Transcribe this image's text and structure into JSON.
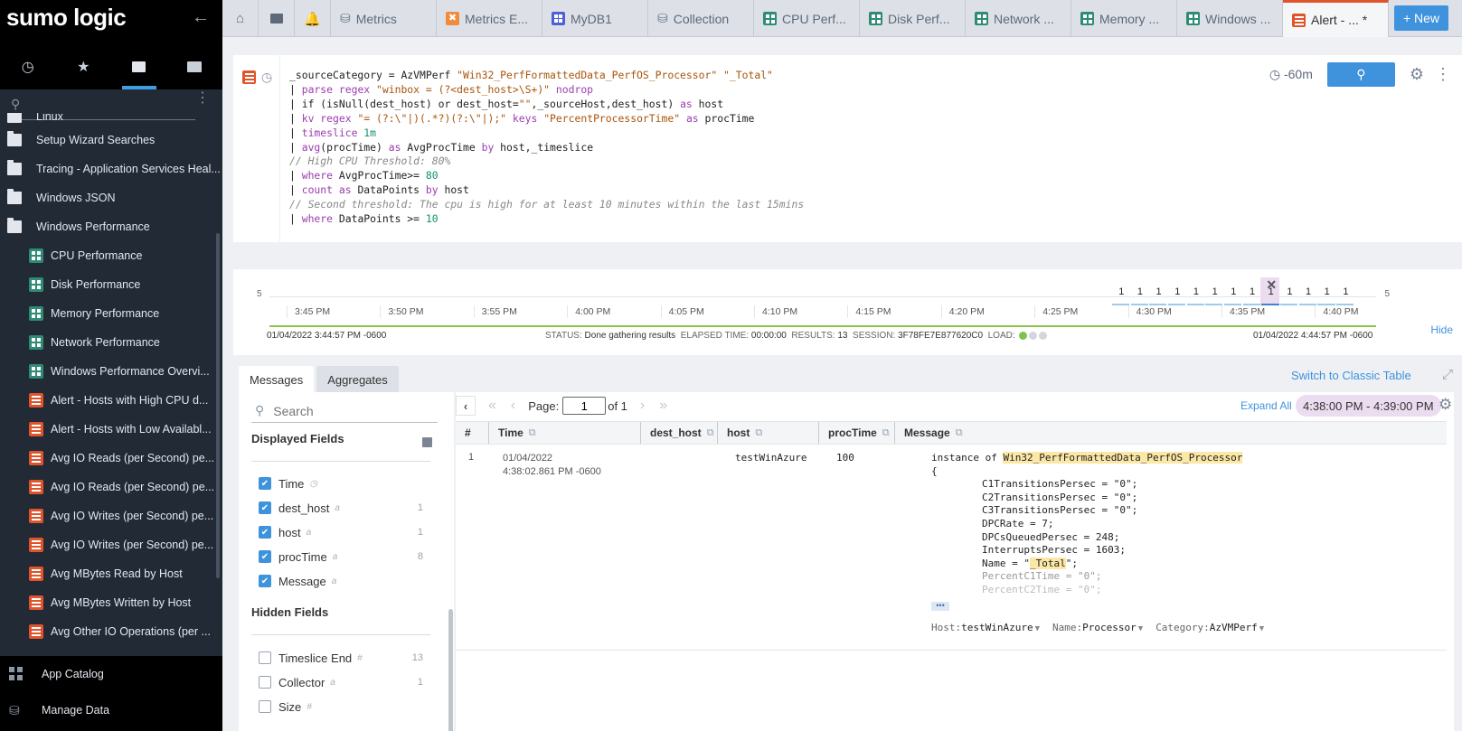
{
  "sidebar": {
    "logo": "sumo logic",
    "tabs": [
      {
        "icon": "clock-icon",
        "label": "Recent"
      },
      {
        "icon": "star-icon",
        "label": "Favorites"
      },
      {
        "icon": "personal-folder-icon",
        "label": "Personal",
        "active": true
      },
      {
        "icon": "library-folder-icon",
        "label": "Library"
      }
    ],
    "search": {
      "placeholder": "",
      "value": ""
    },
    "items": [
      {
        "label": "Linux",
        "type": "folder",
        "level": 0
      },
      {
        "label": "Setup Wizard Searches",
        "type": "folder",
        "level": 0
      },
      {
        "label": "Tracing - Application Services Heal...",
        "type": "folder",
        "level": 0
      },
      {
        "label": "Windows JSON",
        "type": "folder",
        "level": 0
      },
      {
        "label": "Windows Performance",
        "type": "folder-open",
        "level": 0
      },
      {
        "label": "CPU Performance",
        "type": "dashboard",
        "level": 1
      },
      {
        "label": "Disk Performance",
        "type": "dashboard",
        "level": 1
      },
      {
        "label": "Memory Performance",
        "type": "dashboard",
        "level": 1
      },
      {
        "label": "Network Performance",
        "type": "dashboard",
        "level": 1
      },
      {
        "label": "Windows Performance Overvi...",
        "type": "dashboard",
        "level": 1
      },
      {
        "label": "Alert - Hosts with High CPU d...",
        "type": "search",
        "level": 1
      },
      {
        "label": "Alert - Hosts with Low Availabl...",
        "type": "search",
        "level": 1
      },
      {
        "label": "Avg IO Reads (per Second) pe...",
        "type": "search",
        "level": 1
      },
      {
        "label": "Avg IO Reads (per Second) pe...",
        "type": "search",
        "level": 1
      },
      {
        "label": "Avg IO Writes (per Second) pe...",
        "type": "search",
        "level": 1
      },
      {
        "label": "Avg IO Writes (per Second) pe...",
        "type": "search",
        "level": 1
      },
      {
        "label": "Avg MBytes Read by Host",
        "type": "search",
        "level": 1
      },
      {
        "label": "Avg MBytes Written by Host",
        "type": "search",
        "level": 1
      },
      {
        "label": "Avg Other IO Operations (per ...",
        "type": "search",
        "level": 1
      }
    ],
    "bottom": [
      {
        "label": "App Catalog",
        "icon": "app-catalog-icon"
      },
      {
        "label": "Manage Data",
        "icon": "database-icon"
      }
    ]
  },
  "tabbar": {
    "tabs": [
      {
        "label": "Metrics",
        "icon": "database-icon"
      },
      {
        "label": "Metrics E...",
        "icon": "metrics-explorer-icon"
      },
      {
        "label": "MyDB1",
        "icon": "dashboard-blue-icon"
      },
      {
        "label": "Collection",
        "icon": "database-icon"
      },
      {
        "label": "CPU Perf...",
        "icon": "dashboard-icon"
      },
      {
        "label": "Disk Perf...",
        "icon": "dashboard-icon"
      },
      {
        "label": "Network ...",
        "icon": "dashboard-icon"
      },
      {
        "label": "Memory ...",
        "icon": "dashboard-icon"
      },
      {
        "label": "Windows ...",
        "icon": "dashboard-icon"
      },
      {
        "label": "Alert - ... *",
        "icon": "search-doc-icon",
        "active": true
      }
    ],
    "new_label": "+ New"
  },
  "query": {
    "lines": [
      [
        {
          "t": "_sourceCategory = AzVMPerf "
        },
        {
          "c": "str",
          "t": "\"Win32_PerfFormattedData_PerfOS_Processor\" \"_Total\""
        }
      ],
      [
        {
          "t": "| "
        },
        {
          "c": "kw",
          "t": "parse regex "
        },
        {
          "c": "str",
          "t": "\"winbox = (?<dest_host>\\S+)\" "
        },
        {
          "c": "kw",
          "t": "nodrop"
        }
      ],
      [
        {
          "t": "| if (isNull(dest_host) or dest_host="
        },
        {
          "c": "str",
          "t": "\"\""
        },
        {
          "t": ",_sourceHost,dest_host) "
        },
        {
          "c": "kw",
          "t": "as"
        },
        {
          "t": " host"
        }
      ],
      [
        {
          "t": "| "
        },
        {
          "c": "kw",
          "t": "kv regex "
        },
        {
          "c": "str",
          "t": "\"= (?:\\\"|)(.*?)(?:\\\"|);\" "
        },
        {
          "c": "kw",
          "t": "keys "
        },
        {
          "c": "str",
          "t": "\"PercentProcessorTime\" "
        },
        {
          "c": "kw",
          "t": "as"
        },
        {
          "t": " procTime"
        }
      ],
      [
        {
          "t": "| "
        },
        {
          "c": "kw",
          "t": "timeslice "
        },
        {
          "c": "num",
          "t": "1m"
        }
      ],
      [
        {
          "t": "| "
        },
        {
          "c": "kw",
          "t": "avg"
        },
        {
          "t": "(procTime) "
        },
        {
          "c": "kw",
          "t": "as"
        },
        {
          "t": " AvgProcTime "
        },
        {
          "c": "kw",
          "t": "by"
        },
        {
          "t": " host,_timeslice"
        }
      ],
      [
        {
          "c": "cmt",
          "t": "// High CPU Threshold: 80%"
        }
      ],
      [
        {
          "t": "| "
        },
        {
          "c": "kw",
          "t": "where"
        },
        {
          "t": " AvgProcTime>= "
        },
        {
          "c": "num",
          "t": "80"
        }
      ],
      [
        {
          "t": "| "
        },
        {
          "c": "kw",
          "t": "count as"
        },
        {
          "t": " DataPoints "
        },
        {
          "c": "kw",
          "t": "by"
        },
        {
          "t": " host"
        }
      ],
      [
        {
          "c": "cmt",
          "t": "// Second threshold: The cpu is high for at least 10 minutes within the last 15mins"
        }
      ],
      [
        {
          "t": "| "
        },
        {
          "c": "kw",
          "t": "where"
        },
        {
          "t": " DataPoints >= "
        },
        {
          "c": "num",
          "t": "10"
        }
      ]
    ],
    "time_range": "-60m"
  },
  "histogram": {
    "y_max_label": "5",
    "ticks": [
      "3:45 PM",
      "3:50 PM",
      "3:55 PM",
      "4:00 PM",
      "4:05 PM",
      "4:10 PM",
      "4:15 PM",
      "4:20 PM",
      "4:25 PM",
      "4:30 PM",
      "4:35 PM",
      "4:40 PM"
    ],
    "bar_counts": [
      1,
      1,
      1,
      1,
      1,
      1,
      1,
      1,
      1,
      1,
      1,
      1,
      1
    ],
    "selected_bar_index": 8,
    "start_time": "01/04/2022 3:44:57 PM -0600",
    "end_time": "01/04/2022 4:44:57 PM -0600",
    "status_label": "STATUS:",
    "status": "Done gathering results",
    "elapsed_label": "ELAPSED TIME:",
    "elapsed": "00:00:00",
    "results_label": "RESULTS:",
    "results": "13",
    "session_label": "SESSION:",
    "session": "3F78FE7E877620C0",
    "load_label": "LOAD:",
    "load_level": 1,
    "hide_label": "Hide"
  },
  "results": {
    "tabs": [
      {
        "label": "Messages",
        "active": true
      },
      {
        "label": "Aggregates"
      }
    ],
    "switch_classic": "Switch to Classic Table",
    "fields": {
      "search_placeholder": "Search",
      "displayed_title": "Displayed Fields",
      "displayed": [
        {
          "name": "Time",
          "type": "clock",
          "count": "",
          "checked": true
        },
        {
          "name": "dest_host",
          "type": "a",
          "count": "1",
          "checked": true
        },
        {
          "name": "host",
          "type": "a",
          "count": "1",
          "checked": true
        },
        {
          "name": "procTime",
          "type": "a",
          "count": "8",
          "checked": true
        },
        {
          "name": "Message",
          "type": "a",
          "count": "",
          "checked": true
        }
      ],
      "hidden_title": "Hidden Fields",
      "hidden": [
        {
          "name": "Timeslice End",
          "type": "#",
          "count": "13",
          "checked": false
        },
        {
          "name": "Collector",
          "type": "a",
          "count": "1",
          "checked": false
        },
        {
          "name": "Size",
          "type": "#",
          "count": "",
          "checked": false
        }
      ]
    },
    "pager": {
      "page_label": "Page:",
      "page": "1",
      "of_label": "of 1"
    },
    "expand_all": "Expand All",
    "time_filter": "4:38:00 PM - 4:39:00 PM",
    "columns": [
      "#",
      "Time",
      "dest_host",
      "host",
      "procTime",
      "Message"
    ],
    "rows": [
      {
        "num": "1",
        "date": "01/04/2022",
        "time": "4:38:02.861 PM -0600",
        "dest_host": "",
        "host": "testWinAzure",
        "procTime": "100",
        "message": {
          "prefix": "instance of ",
          "class": "Win32_PerfFormattedData_PerfOS_Processor",
          "open": "{",
          "lines": [
            "C1TransitionsPersec = \"0\";",
            "C2TransitionsPersec = \"0\";",
            "C3TransitionsPersec = \"0\";",
            "DPCRate = 7;",
            "DPCsQueuedPersec = 248;",
            "InterruptsPersec = 1603;"
          ],
          "name_prefix": "Name = \"",
          "name_value": "_Total",
          "name_suffix": "\";",
          "faded": [
            "PercentC1Time = \"0\";",
            "PercentC2Time = \"0\";"
          ]
        },
        "meta": [
          {
            "key": "Host:",
            "value": "testWinAzure"
          },
          {
            "key": "Name:",
            "value": "Processor"
          },
          {
            "key": "Category:",
            "value": "AzVMPerf"
          }
        ]
      }
    ]
  }
}
